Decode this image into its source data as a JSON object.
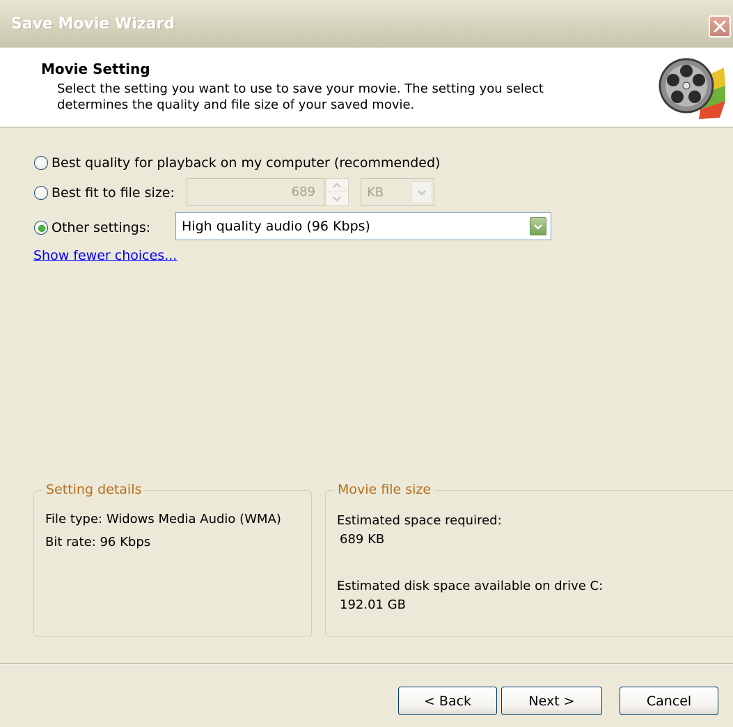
{
  "window": {
    "title": "Save Movie Wizard",
    "close_icon": "close-icon"
  },
  "header": {
    "title": "Movie Setting",
    "description": "Select the setting you want to use to save your movie. The setting you select determines the quality and file size of your saved movie.",
    "icon": "movie-reel-icon"
  },
  "options": {
    "best_quality_label": "Best quality for playback on my computer (recommended)",
    "best_fit_label": "Best fit to file size:",
    "best_fit_value": "689",
    "best_fit_unit": "KB",
    "other_settings_label": "Other settings:",
    "other_settings_value": "High quality audio (96 Kbps)",
    "selected": "other_settings",
    "show_fewer_link": "Show fewer choices..."
  },
  "setting_details": {
    "legend": "Setting details",
    "file_type": "File type: Widows Media Audio (WMA)",
    "bit_rate": "Bit rate: 96 Kbps"
  },
  "movie_file_size": {
    "legend": "Movie file size",
    "estimated_label": "Estimated space required:",
    "estimated_value": "689 KB",
    "available_label": "Estimated disk space available on drive C:",
    "available_value": "192.01 GB"
  },
  "buttons": {
    "back": "< Back",
    "next": "Next >",
    "cancel": "Cancel"
  },
  "colors": {
    "dialog_bg": "#ece9d8",
    "group_legend": "#b56e1c",
    "link": "#0000ff",
    "radio_selected": "#3fb93b"
  }
}
